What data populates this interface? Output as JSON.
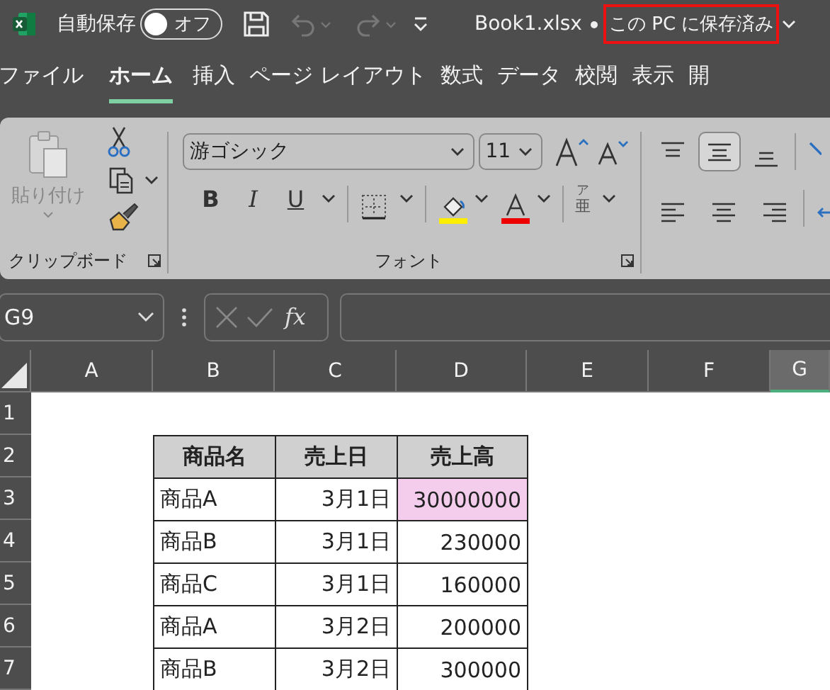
{
  "title_bar": {
    "autosave_label": "自動保存",
    "autosave": {
      "label": "オフ",
      "on": false
    },
    "file_name": "Book1.xlsx",
    "save_status": "この PC に保存済み"
  },
  "ribbon_tabs": [
    {
      "label": "ファイル",
      "selected": false
    },
    {
      "label": "ホーム",
      "selected": true
    },
    {
      "label": "挿入",
      "selected": false
    },
    {
      "label": "ページ レイアウト",
      "selected": false
    },
    {
      "label": "数式",
      "selected": false
    },
    {
      "label": "データ",
      "selected": false
    },
    {
      "label": "校閲",
      "selected": false
    },
    {
      "label": "表示",
      "selected": false
    },
    {
      "label": "開",
      "selected": false
    }
  ],
  "clipboard_group": {
    "paste_label": "貼り付け",
    "group_label": "クリップボード"
  },
  "font_group": {
    "font_name": "游ゴシック",
    "font_size": "11",
    "bold": "B",
    "italic": "I",
    "underline": "U",
    "phonetic_ruby": "ア",
    "phonetic_base": "亜",
    "group_label": "フォント"
  },
  "formula_bar": {
    "name_box": "G9",
    "function_label": "fx"
  },
  "columns": [
    {
      "label": "A",
      "selected": false
    },
    {
      "label": "B",
      "selected": false
    },
    {
      "label": "C",
      "selected": false
    },
    {
      "label": "D",
      "selected": false
    },
    {
      "label": "E",
      "selected": false
    },
    {
      "label": "F",
      "selected": false
    },
    {
      "label": "G",
      "selected": true
    }
  ],
  "row_numbers": [
    "1",
    "2",
    "3",
    "4",
    "5",
    "6",
    "7"
  ],
  "table": {
    "headers": [
      "商品名",
      "売上日",
      "売上高"
    ],
    "rows": [
      {
        "product": "商品A",
        "date": "3月1日",
        "sales": "30000000",
        "sales_highlighted": true
      },
      {
        "product": "商品B",
        "date": "3月1日",
        "sales": "230000",
        "sales_highlighted": false
      },
      {
        "product": "商品C",
        "date": "3月1日",
        "sales": "160000",
        "sales_highlighted": false
      },
      {
        "product": "商品A",
        "date": "3月2日",
        "sales": "200000",
        "sales_highlighted": false
      },
      {
        "product": "商品B",
        "date": "3月2日",
        "sales": "300000",
        "sales_highlighted": false
      }
    ]
  }
}
